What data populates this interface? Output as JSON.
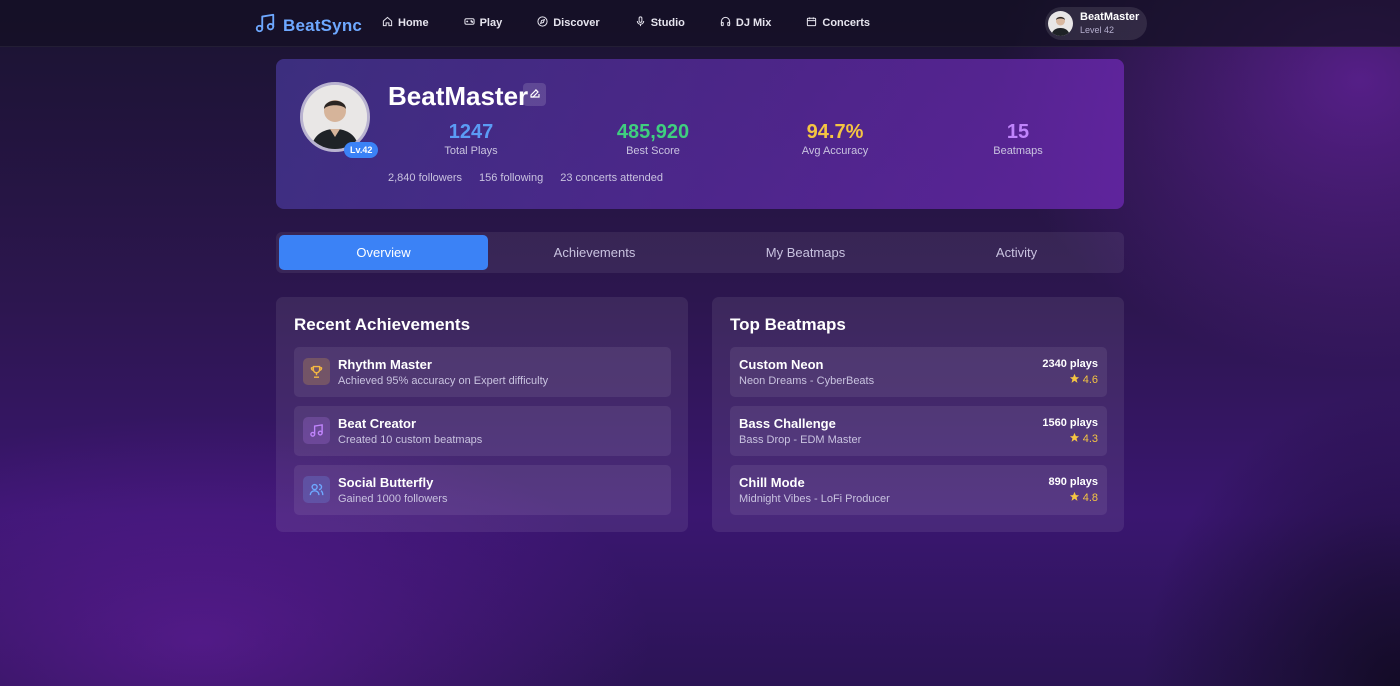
{
  "nav": {
    "brand": "BeatSync",
    "links": [
      {
        "label": "Home",
        "icon": "home-icon"
      },
      {
        "label": "Play",
        "icon": "gamepad-icon"
      },
      {
        "label": "Discover",
        "icon": "compass-icon"
      },
      {
        "label": "Studio",
        "icon": "microphone-icon"
      },
      {
        "label": "DJ Mix",
        "icon": "headphones-icon"
      },
      {
        "label": "Concerts",
        "icon": "calendar-icon"
      }
    ],
    "user": {
      "name": "BeatMaster",
      "level": "Level 42"
    }
  },
  "profile": {
    "name": "BeatMaster",
    "level_badge": "Lv.42",
    "stats": [
      {
        "value": "1247",
        "label": "Total Plays",
        "color": "#5b9cf5"
      },
      {
        "value": "485,920",
        "label": "Best Score",
        "color": "#3fcf7f"
      },
      {
        "value": "94.7%",
        "label": "Avg Accuracy",
        "color": "#f5c542"
      },
      {
        "value": "15",
        "label": "Beatmaps",
        "color": "#c084fc"
      }
    ],
    "social": {
      "followers": "2,840 followers",
      "following": "156 following",
      "concerts": "23 concerts attended"
    }
  },
  "tabs": [
    {
      "label": "Overview",
      "active": true
    },
    {
      "label": "Achievements",
      "active": false
    },
    {
      "label": "My Beatmaps",
      "active": false
    },
    {
      "label": "Activity",
      "active": false
    }
  ],
  "achievements": {
    "title": "Recent Achievements",
    "items": [
      {
        "title": "Rhythm Master",
        "desc": "Achieved 95% accuracy on Expert difficulty",
        "icon": "trophy-icon",
        "color": "#f5b942"
      },
      {
        "title": "Beat Creator",
        "desc": "Created 10 custom beatmaps",
        "icon": "music-note-icon",
        "color": "#c084fc"
      },
      {
        "title": "Social Butterfly",
        "desc": "Gained 1000 followers",
        "icon": "users-icon",
        "color": "#6ea8ff"
      }
    ]
  },
  "beatmaps": {
    "title": "Top Beatmaps",
    "items": [
      {
        "title": "Custom Neon",
        "subtitle": "Neon Dreams - CyberBeats",
        "plays": "2340 plays",
        "rating": "4.6"
      },
      {
        "title": "Bass Challenge",
        "subtitle": "Bass Drop - EDM Master",
        "plays": "1560 plays",
        "rating": "4.3"
      },
      {
        "title": "Chill Mode",
        "subtitle": "Midnight Vibes - LoFi Producer",
        "plays": "890 plays",
        "rating": "4.8"
      }
    ]
  },
  "colors": {
    "accent": "#3b82f6",
    "star": "#f5c542"
  }
}
